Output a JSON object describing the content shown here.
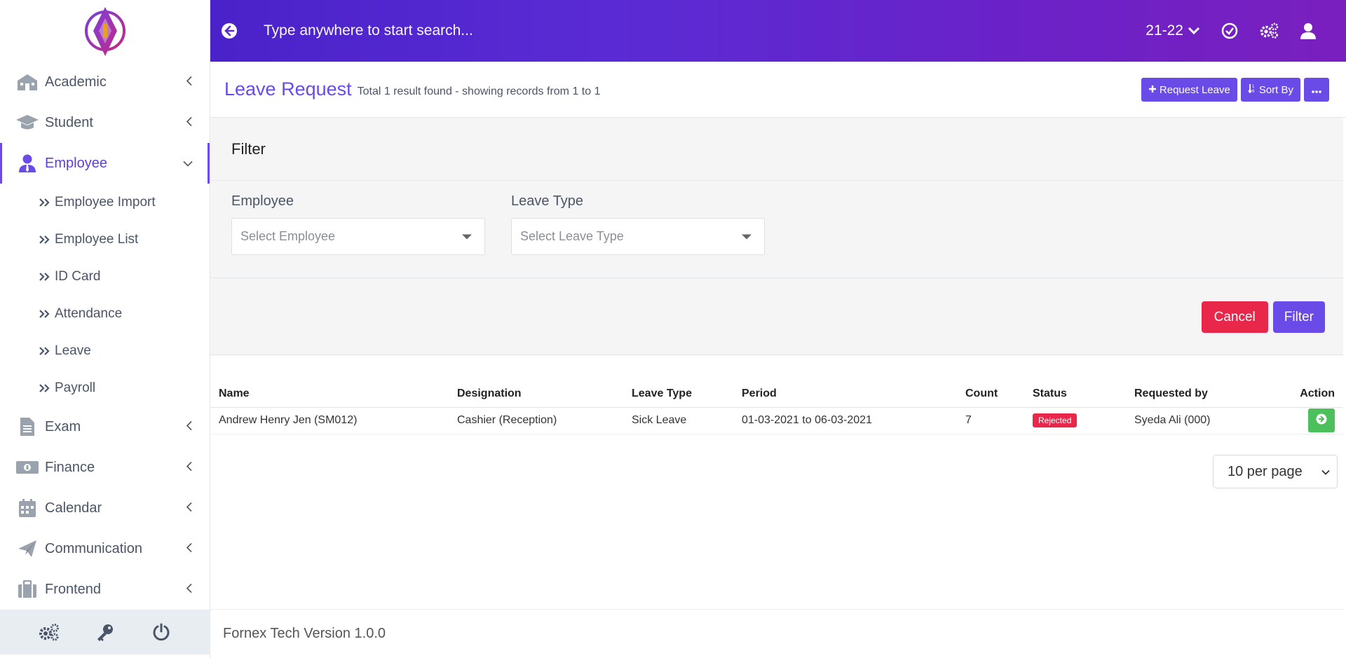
{
  "topbar": {
    "search_placeholder": "Type anywhere to start search...",
    "year": "21-22"
  },
  "sidebar": {
    "items": [
      {
        "label": "Academic",
        "icon": "school-icon"
      },
      {
        "label": "Student",
        "icon": "graduation-cap-icon"
      },
      {
        "label": "Employee",
        "icon": "user-tie-icon",
        "active": true
      },
      {
        "label": "Exam",
        "icon": "file-icon"
      },
      {
        "label": "Finance",
        "icon": "money-icon"
      },
      {
        "label": "Calendar",
        "icon": "calendar-icon"
      },
      {
        "label": "Communication",
        "icon": "paper-plane-icon"
      },
      {
        "label": "Frontend",
        "icon": "briefcase-icon"
      }
    ],
    "employee_submenu": [
      "Employee Import",
      "Employee List",
      "ID Card",
      "Attendance",
      "Leave",
      "Payroll"
    ]
  },
  "page": {
    "title": "Leave Request",
    "subtitle": "Total 1 result found - showing records from 1 to 1",
    "request_leave_label": "Request Leave",
    "sort_by_label": "Sort By"
  },
  "filter": {
    "title": "Filter",
    "employee_label": "Employee",
    "employee_placeholder": "Select Employee",
    "leave_type_label": "Leave Type",
    "leave_type_placeholder": "Select Leave Type",
    "cancel_label": "Cancel",
    "filter_label": "Filter"
  },
  "table": {
    "headers": [
      "Name",
      "Designation",
      "Leave Type",
      "Period",
      "Count",
      "Status",
      "Requested by",
      "Action"
    ],
    "rows": [
      {
        "name": "Andrew Henry Jen (SM012)",
        "designation": "Cashier (Reception)",
        "leave_type": "Sick Leave",
        "period": "01-03-2021 to 06-03-2021",
        "count": "7",
        "status": "Rejected",
        "requested_by": "Syeda Ali (000)"
      }
    ]
  },
  "pagination": {
    "per_page": "10 per page"
  },
  "footer": {
    "text": "Fornex Tech Version 1.0.0"
  },
  "colors": {
    "accent": "#6a4be8",
    "danger": "#e8274b",
    "success": "#4cc05a"
  }
}
